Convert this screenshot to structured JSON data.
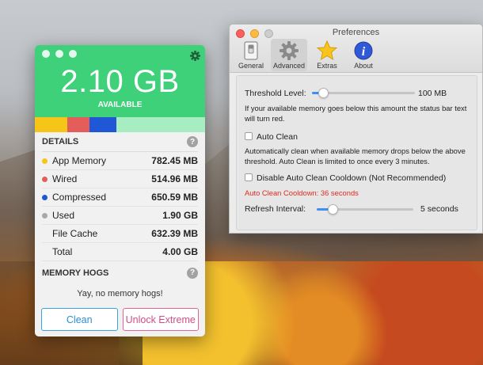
{
  "preferences": {
    "title": "Preferences",
    "toolbar": [
      {
        "label": "General",
        "icon": "general-switch-icon"
      },
      {
        "label": "Advanced",
        "icon": "gear-icon"
      },
      {
        "label": "Extras",
        "icon": "star-icon"
      },
      {
        "label": "About",
        "icon": "info-icon"
      }
    ],
    "threshold": {
      "label": "Threshold Level:",
      "value": "100 MB",
      "level": 0.08
    },
    "threshold_desc": "If your available memory goes below this amount the status bar text will turn red.",
    "auto_clean": {
      "label": "Auto Clean",
      "checked": false
    },
    "auto_clean_desc": "Automatically clean when available memory drops below the above threshold. Auto Clean is limited to once every 3 minutes.",
    "disable_cooldown": {
      "label": "Disable Auto Clean Cooldown (Not Recommended)",
      "checked": false
    },
    "cooldown_text": "Auto Clean Cooldown: 36 seconds",
    "refresh": {
      "label": "Refresh Interval:",
      "value": "5 seconds",
      "level": 0.15
    }
  },
  "memory": {
    "available_value": "2.10 GB",
    "available_label": "AVAILABLE",
    "bar": [
      {
        "color": "#f5c518",
        "fraction": 0.19
      },
      {
        "color": "#e35d5b",
        "fraction": 0.13
      },
      {
        "color": "#1f57d6",
        "fraction": 0.16
      },
      {
        "color": "#a8a8a8",
        "fraction": 0.0
      },
      {
        "color": "#a6edc2",
        "fraction": 0.52
      }
    ],
    "details_label": "DETAILS",
    "rows": [
      {
        "label": "App Memory",
        "value": "782.45 MB",
        "color": "#f5c518"
      },
      {
        "label": "Wired",
        "value": "514.96 MB",
        "color": "#e35d5b"
      },
      {
        "label": "Compressed",
        "value": "650.59 MB",
        "color": "#1f57d6"
      },
      {
        "label": "Used",
        "value": "1.90 GB",
        "color": "#a8a8a8"
      },
      {
        "label": "File Cache",
        "value": "632.39 MB",
        "color": ""
      },
      {
        "label": "Total",
        "value": "4.00 GB",
        "color": ""
      }
    ],
    "hogs_label": "MEMORY HOGS",
    "hogs_message": "Yay, no memory hogs!",
    "clean_button": "Clean",
    "extreme_button": "Unlock Extreme",
    "help_symbol": "?"
  }
}
